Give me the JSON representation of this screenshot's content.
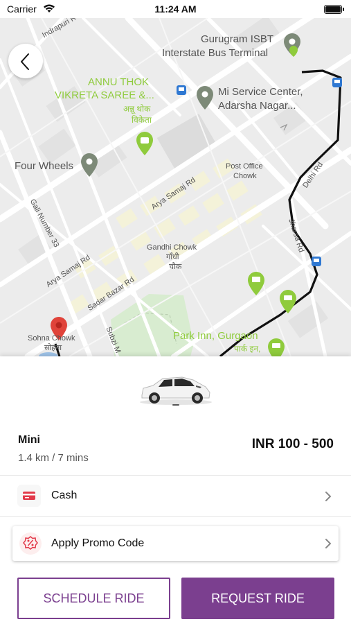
{
  "status_bar": {
    "carrier": "Carrier",
    "time": "11:24 AM",
    "icons": [
      "wifi-icon",
      "battery-icon"
    ]
  },
  "map": {
    "places": {
      "isbt_line1": "Gurugram ISBT",
      "isbt_line2": "Interstate Bus Terminal",
      "annu_line1": "ANNU THOK",
      "annu_line2": "VIKRETA SAREE &...",
      "annu_hindi1": "अन्नू थोक",
      "annu_hindi2": "विकेता",
      "mi_line1": "Mi Service Center,",
      "mi_line2": "Adarsha Nagar...",
      "four_wheels": "Four Wheels",
      "post_office_line1": "Post Office",
      "post_office_line2": "Chowk",
      "gandhi_chowk": "Gandhi Chowk",
      "gandhi_hindi1": "गाँधी",
      "gandhi_hindi2": "चौक",
      "sohna_chowk": "Sohna Chowk",
      "sohna_hindi": "सोहना",
      "park_inn": "Park Inn, Gurgaon",
      "park_inn_hindi": "पार्क इन,"
    },
    "roads": {
      "indrapuri": "Indrapuri R",
      "arya_samaj_1": "Arya Samaj Rd",
      "arya_samaj_2": "Arya Samaj Rd",
      "gali": "Gali Number 33",
      "sadar_bazar": "Sadar Bazar Rd",
      "subzi": "Subzi M",
      "delhi_rd": "Delhi Rd",
      "jharsa": "Jharsa Rd"
    },
    "colors": {
      "route": "#111111",
      "green_poi": "#8fcb3c",
      "pin_red": "#e0433a",
      "pin_gray": "#7d8a78"
    }
  },
  "ride": {
    "vehicle_icon": "car-icon",
    "name": "Mini",
    "meta": "1.4 km / 7 mins",
    "fare": "INR 100 - 500"
  },
  "payment": {
    "icon": "card-icon",
    "label": "Cash"
  },
  "promo": {
    "icon": "discount-icon",
    "label": "Apply Promo Code"
  },
  "actions": {
    "schedule_label": "SCHEDULE RIDE",
    "request_label": "REQUEST RIDE"
  },
  "theme": {
    "accent": "#7b3f8f"
  }
}
